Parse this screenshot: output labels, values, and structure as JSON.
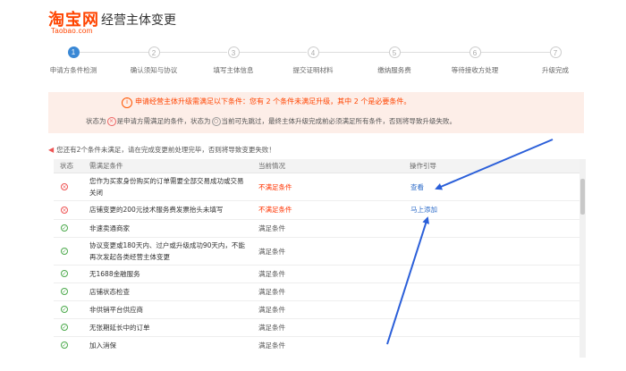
{
  "header": {
    "logo_cn": "淘宝网",
    "logo_en": "Taobao.com",
    "title": "经营主体变更"
  },
  "steps": [
    {
      "num": "1",
      "label": "申请方条件检测",
      "state": "active"
    },
    {
      "num": "2",
      "label": "确认须知与协议",
      "state": "pending"
    },
    {
      "num": "3",
      "label": "填写主体信息",
      "state": "pending"
    },
    {
      "num": "4",
      "label": "提交证明材料",
      "state": "pending"
    },
    {
      "num": "5",
      "label": "缴纳服务费",
      "state": "pending"
    },
    {
      "num": "6",
      "label": "等待接收方处理",
      "state": "pending"
    },
    {
      "num": "7",
      "label": "升级完成",
      "state": "pending"
    }
  ],
  "notice": {
    "icon": "i",
    "line1": "申请经营主体升级需满足以下条件：您有 2 个条件未满足升级，其中 2 个是必要条件。",
    "line2_a": "状态为",
    "line2_b": "是申请方需满足的条件，状态为",
    "line2_c": "当前可先跳过，最终主体升级完成前必须满足所有条件，否则将导致升级失败。"
  },
  "warning": "您还有2个条件未满足，请在完成变更前处理完毕，否则将导致变更失败！",
  "table": {
    "headers": {
      "status": "状态",
      "condition": "需满足条件",
      "current": "当前情况",
      "action": "操作引导"
    },
    "rows": [
      {
        "status": "fail",
        "condition_l1": "您作为买家身份购买的订单需要全部交易成功或交易",
        "condition_l2": "关闭",
        "current": "不满足条件",
        "action": "查看"
      },
      {
        "status": "fail",
        "condition_l1": "店铺变更的200元技术服务费发票抬头未填写",
        "condition_l2": "",
        "current": "不满足条件",
        "action": "马上添加"
      },
      {
        "status": "ok",
        "condition_l1": "非速卖通商家",
        "condition_l2": "",
        "current": "满足条件",
        "action": ""
      },
      {
        "status": "ok",
        "condition_l1": "协议变更或180天内、过户或升级成功90天内，不能",
        "condition_l2": "再次发起各类经营主体变更",
        "current": "满足条件",
        "action": ""
      },
      {
        "status": "ok",
        "condition_l1": "无1688金融服务",
        "condition_l2": "",
        "current": "满足条件",
        "action": ""
      },
      {
        "status": "ok",
        "condition_l1": "店铺状态检查",
        "condition_l2": "",
        "current": "满足条件",
        "action": ""
      },
      {
        "status": "ok",
        "condition_l1": "非供销平台供应商",
        "condition_l2": "",
        "current": "满足条件",
        "action": ""
      },
      {
        "status": "ok",
        "condition_l1": "无张期延长中的订单",
        "condition_l2": "",
        "current": "满足条件",
        "action": ""
      },
      {
        "status": "ok",
        "condition_l1": "加入消保",
        "condition_l2": "",
        "current": "满足条件",
        "action": ""
      }
    ]
  },
  "colors": {
    "brand": "#ff4400",
    "accent": "#3a88d5",
    "fail": "#ff3300",
    "ok": "#4caa4c",
    "link": "#2c6bc8",
    "annotation_arrow": "#2b5fd9"
  }
}
